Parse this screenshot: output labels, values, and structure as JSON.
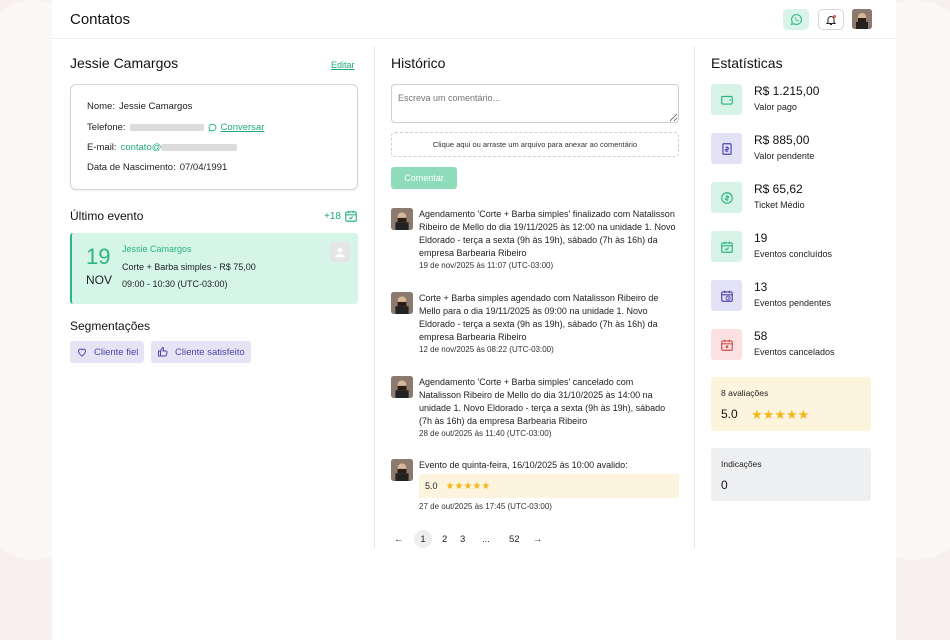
{
  "header": {
    "title": "Contatos"
  },
  "contact": {
    "name": "Jessie Camargos",
    "edit_label": "Editar",
    "fields": {
      "nome_label": "Nome:",
      "nome_value": "Jessie Camargos",
      "telefone_label": "Telefone:",
      "conversar_label": "Conversar",
      "email_label": "E-mail:",
      "email_value": "contato@",
      "nascimento_label": "Data de Nascimento:",
      "nascimento_value": "07/04/1991"
    }
  },
  "last_event": {
    "heading": "Último evento",
    "count_badge": "+18",
    "day": "19",
    "month": "NOV",
    "client": "Jessie Camargos",
    "service": "Corte + Barba simples - R$ 75,00",
    "time": "09:00 - 10:30 (UTC-03:00)"
  },
  "segments": {
    "heading": "Segmentações",
    "tags": [
      "Cliente fiel",
      "Cliente satisfeito"
    ]
  },
  "history": {
    "heading": "Histórico",
    "comment_placeholder": "Escreva um comentário...",
    "dropzone_text": "Clique aqui ou arraste um arquivo para anexar ao comentário",
    "comment_button": "Comentar",
    "items": [
      {
        "text": "Agendamento 'Corte + Barba simples' finalizado com Natalisson Ribeiro de Mello do dia 19/11/2025 às 12:00 na unidade 1. Novo Eldorado - terça a sexta (9h às 19h), sábado (7h às 16h) da empresa Barbearia Ribeiro",
        "date": "19 de nov/2025 às 11:07 (UTC-03:00)"
      },
      {
        "text": "Corte + Barba simples agendado com Natalisson Ribeiro de Mello para o dia 19/11/2025 às 09:00 na unidade 1. Novo Eldorado - terça a sexta (9h as 19h), sábado (7h às 16h) da empresa Barbearia Ribeiro",
        "date": "12 de nov/2025 às 08:22 (UTC-03:00)"
      },
      {
        "text": "Agendamento 'Corte + Barba simples' cancelado com Natalisson Ribeiro de Mello do dia 31/10/2025 às 14:00 na unidade 1. Novo Eldorado - terça a sexta (9h às 19h), sábado (7h às 16h) da empresa Barbearia Ribeiro",
        "date": "28 de out/2025 às 11:40 (UTC-03:00)"
      },
      {
        "text": "Evento de quinta-feira, 16/10/2025 às 10:00 avalido:",
        "rating": "5.0",
        "stars": 5,
        "date": "27 de out/2025 às 17:45 (UTC-03:00)"
      }
    ],
    "pagination": {
      "prev": "←",
      "pages": [
        "1",
        "2",
        "3",
        "...",
        "52"
      ],
      "current": "1",
      "next": "→"
    }
  },
  "stats": {
    "heading": "Estatísticas",
    "items": [
      {
        "value": "R$ 1.215,00",
        "label": "Valor pago",
        "icon": "wallet-icon",
        "bg": "#d7f3e8",
        "color": "#2bb585"
      },
      {
        "value": "R$ 885,00",
        "label": "Valor pendente",
        "icon": "invoice-icon",
        "bg": "#e3e1f6",
        "color": "#4a47a8"
      },
      {
        "value": "R$ 65,62",
        "label": "Ticket Médio",
        "icon": "coin-icon",
        "bg": "#d7f3e8",
        "color": "#2bb585"
      },
      {
        "value": "19",
        "label": "Eventos concluídos",
        "icon": "calendar-check-icon",
        "bg": "#d7f3e8",
        "color": "#2bb585"
      },
      {
        "value": "13",
        "label": "Eventos pendentes",
        "icon": "calendar-clock-icon",
        "bg": "#e3e1f6",
        "color": "#4a47a8"
      },
      {
        "value": "58",
        "label": "Eventos cancelados",
        "icon": "calendar-x-icon",
        "bg": "#fbe1e1",
        "color": "#d14d4d"
      }
    ],
    "reviews": {
      "label": "8 avaliações",
      "score": "5.0",
      "stars": 5
    },
    "referrals": {
      "label": "Indicações",
      "value": "0"
    }
  },
  "colors": {
    "accent": "#2bb585",
    "purple": "#4a47a8",
    "star": "#f0b81c"
  }
}
